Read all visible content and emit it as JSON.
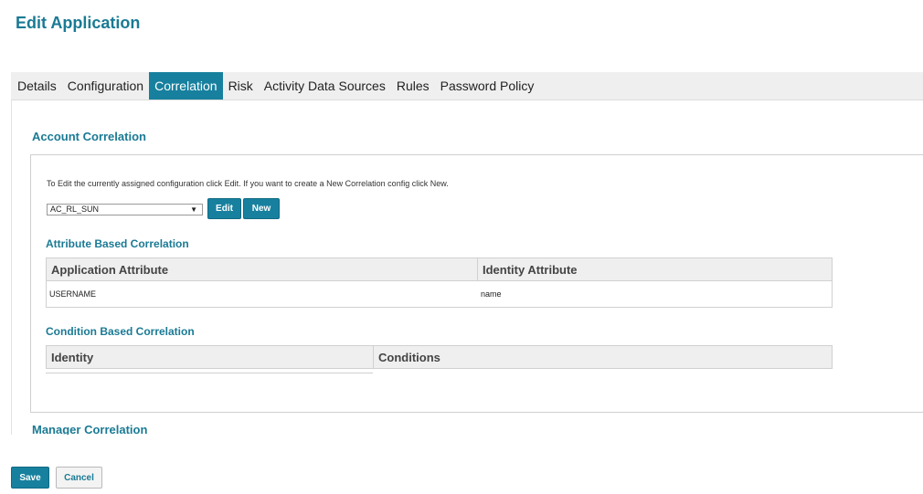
{
  "page": {
    "title": "Edit Application"
  },
  "tabs": [
    {
      "label": "Details",
      "active": false
    },
    {
      "label": "Configuration",
      "active": false
    },
    {
      "label": "Correlation",
      "active": true
    },
    {
      "label": "Risk",
      "active": false
    },
    {
      "label": "Activity Data Sources",
      "active": false
    },
    {
      "label": "Rules",
      "active": false
    },
    {
      "label": "Password Policy",
      "active": false
    }
  ],
  "account_correlation": {
    "title": "Account Correlation",
    "instructions": "To Edit the currently assigned configuration click Edit. If you want to create a New Correlation config click New.",
    "config_select": {
      "selected": "AC_RL_SUN"
    },
    "edit_label": "Edit",
    "new_label": "New",
    "attribute_based": {
      "title": "Attribute Based Correlation",
      "columns": [
        "Application Attribute",
        "Identity Attribute"
      ],
      "rows": [
        {
          "application_attribute": "USERNAME",
          "identity_attribute": "name"
        }
      ]
    },
    "condition_based": {
      "title": "Condition Based Correlation",
      "columns": [
        "Identity",
        "Conditions"
      ]
    }
  },
  "manager_correlation": {
    "title": "Manager Correlation"
  },
  "footer": {
    "save_label": "Save",
    "cancel_label": "Cancel"
  },
  "colors": {
    "accent": "#17809e",
    "title": "#1a7a94",
    "tabbar_bg": "#efefef"
  },
  "icons": {
    "select_arrow": "triangle-down-icon"
  }
}
